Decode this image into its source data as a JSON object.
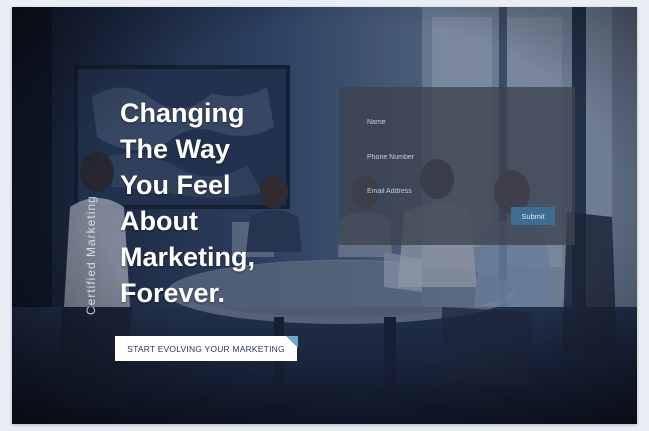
{
  "hero": {
    "vertical_label": "Certified Marketing",
    "headline_lines": [
      "Changing",
      "The Way",
      "You Feel",
      "About",
      "Marketing,",
      "Forever."
    ],
    "cta_label": "START EVOLVING YOUR MARKETING"
  },
  "form": {
    "name_placeholder": "Name",
    "phone_placeholder": "Phone Number",
    "email_placeholder": "Email Address",
    "submit_label": "Submit"
  },
  "colors": {
    "overlay": "#1d2a3d",
    "accent": "#3d6e92",
    "cta_corner": "#6fa6c9"
  }
}
